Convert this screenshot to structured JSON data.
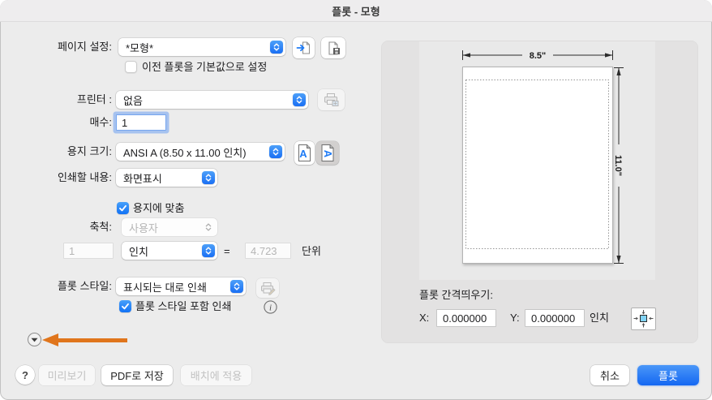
{
  "window": {
    "title": "플롯 - 모형"
  },
  "form": {
    "page_setup_label": "페이지 설정:",
    "page_setup_value": "*모형*",
    "prev_plot_default": "이전 플롯을 기본값으로 설정",
    "printer_label": "프린터 :",
    "printer_value": "없음",
    "copies_label": "매수:",
    "copies_value": "1",
    "paper_size_label": "용지 크기:",
    "paper_size_value": "ANSI A (8.50 x 11.00 인치)",
    "print_what_label": "인쇄할 내용:",
    "print_what_value": "화면표시",
    "fit_to_paper": "용지에 맞춤",
    "scale_label": "축척:",
    "scale_value": "사용자",
    "scale_number": "1",
    "scale_unit_value": "인치",
    "equals": "=",
    "scale_units_number": "4.723",
    "units_label": "단위",
    "plot_style_label": "플롯 스타일:",
    "plot_style_value": "표시되는 대로 인쇄",
    "plot_with_styles": "플롯 스타일 포함 인쇄"
  },
  "preview": {
    "paper_width": "8.5\"",
    "paper_height": "11.0\"",
    "offset_title": "플롯 간격띄우기:",
    "x_label": "X:",
    "x_value": "0.000000",
    "y_label": "Y:",
    "y_value": "0.000000",
    "unit_label": "인치"
  },
  "footer": {
    "help": "?",
    "preview": "미리보기",
    "save_pdf": "PDF로 저장",
    "apply_to_layout": "배치에 적용",
    "cancel": "취소",
    "plot": "플롯"
  },
  "colors": {
    "accent": "#1772f6",
    "annotation_arrow": "#e0751c",
    "window_bg": "#ececec"
  }
}
